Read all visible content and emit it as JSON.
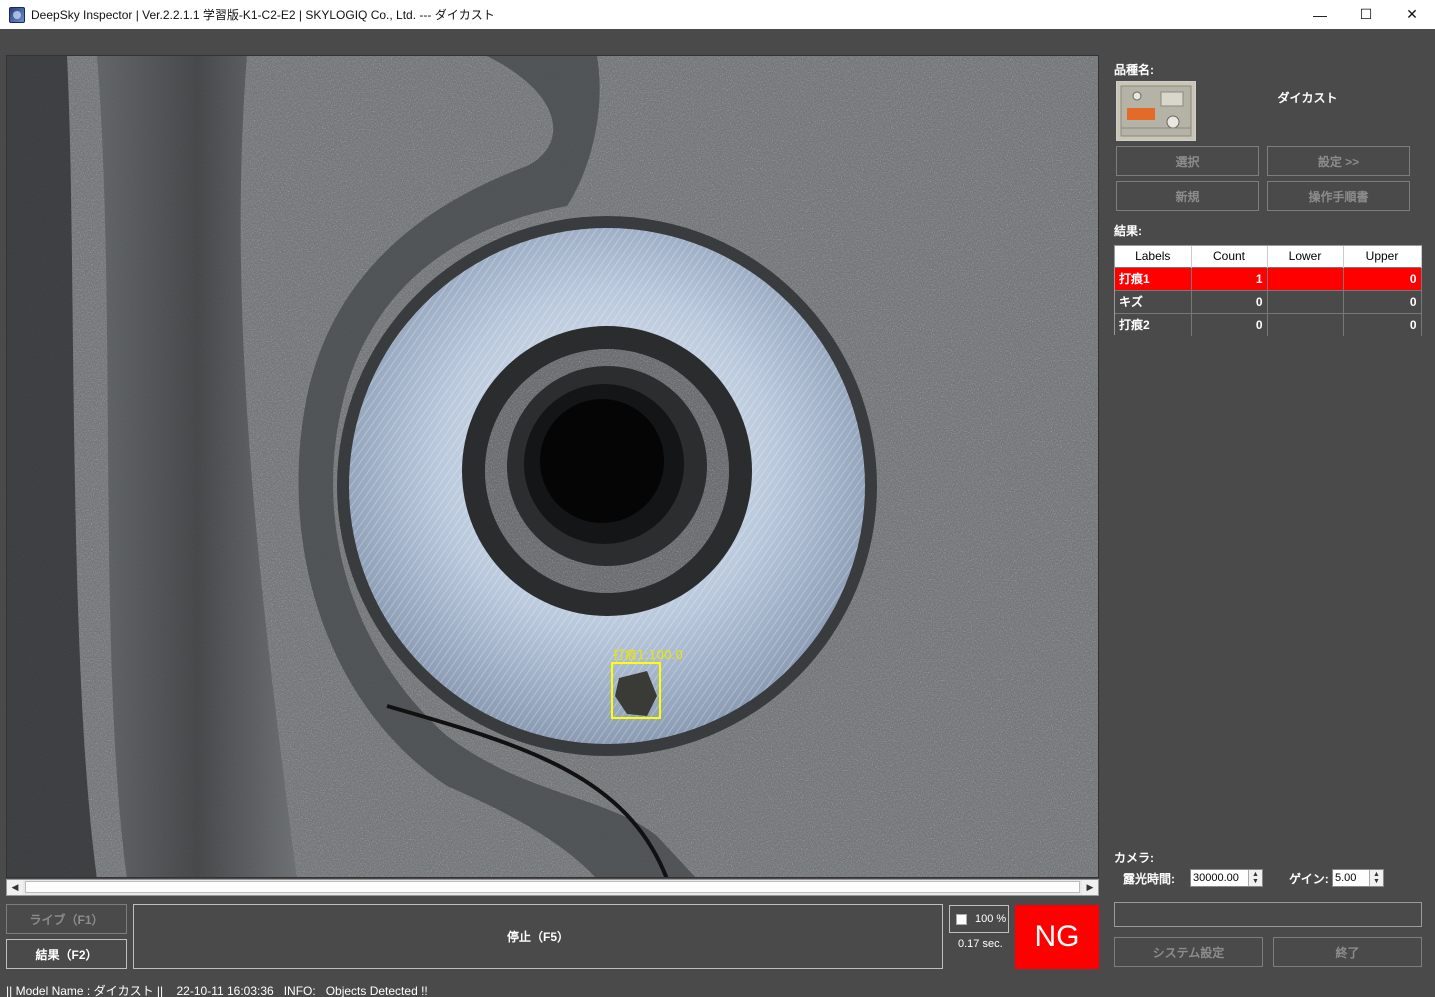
{
  "window": {
    "title": "DeepSky Inspector | Ver.2.2.1.1 学習版-K1-C2-E2 | SKYLOGIQ Co., Ltd. --- ダイカスト",
    "minimize": "—",
    "maximize": "☐",
    "close": "✕"
  },
  "viewer": {
    "detection_label": "打痕1:100.0"
  },
  "controls": {
    "live_label": "ライブ（F1）",
    "result_label": "結果（F2）",
    "stop_label": "停止（F5）",
    "zoom_label": "100 %",
    "elapsed": "0.17 sec.",
    "verdict": "NG",
    "status_text": "|| Model Name : ダイカスト ||    22-10-11 16:03:36   INFO:   Objects Detected !!"
  },
  "product": {
    "heading": "品種名:",
    "name": "ダイカスト",
    "select_label": "選択",
    "settings_label": "設定 >>",
    "new_label": "新規",
    "manual_label": "操作手順書"
  },
  "results": {
    "heading": "結果:",
    "columns": [
      "Labels",
      "Count",
      "Lower",
      "Upper"
    ],
    "rows": [
      {
        "label": "打痕1",
        "count": "1",
        "lower": "",
        "upper": "0",
        "ng": true
      },
      {
        "label": "キズ",
        "count": "0",
        "lower": "",
        "upper": "0",
        "ng": false
      },
      {
        "label": "打痕2",
        "count": "0",
        "lower": "",
        "upper": "0",
        "ng": false
      }
    ]
  },
  "camera": {
    "heading": "カメラ:",
    "exposure_label": "露光時間:",
    "exposure_value": "30000.00",
    "gain_label": "ゲイン:",
    "gain_value": "5.00",
    "system_settings_label": "システム設定",
    "exit_label": "終了"
  }
}
